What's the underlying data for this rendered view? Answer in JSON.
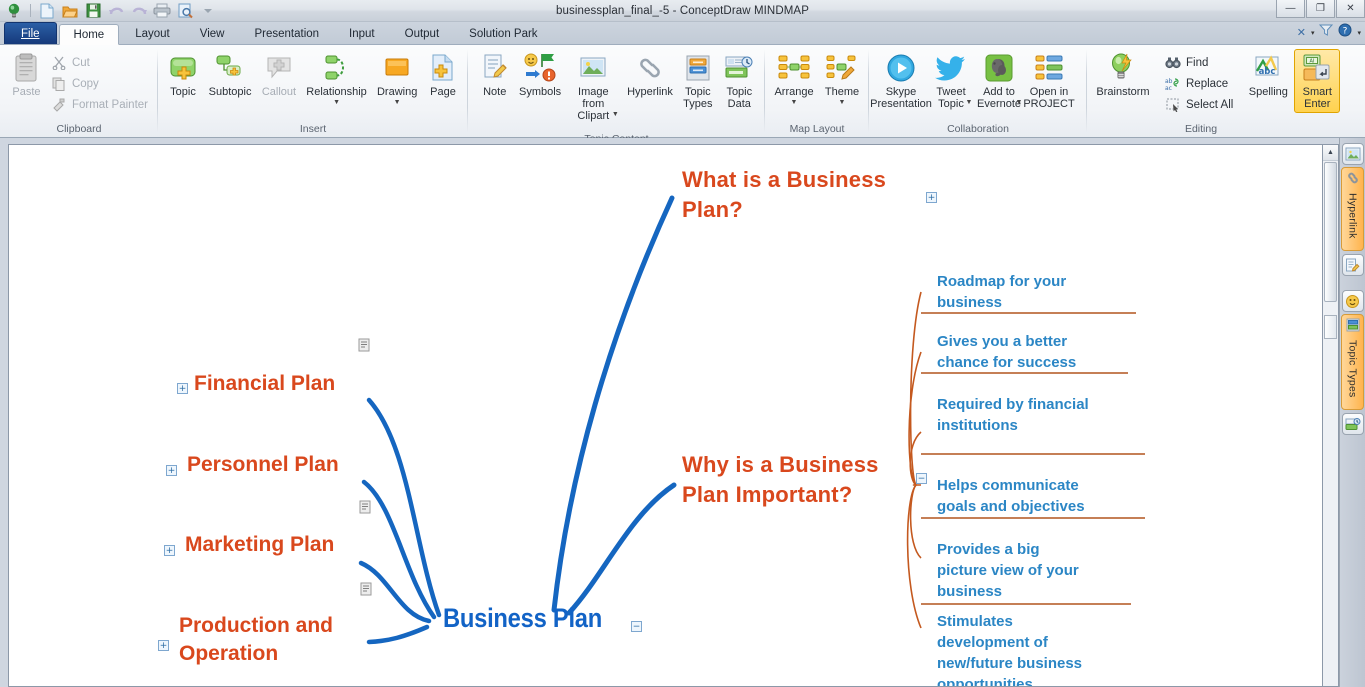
{
  "window": {
    "title": "businessplan_final_-5 - ConceptDraw MINDMAP",
    "controls": {
      "minimize": "—",
      "restore": "❐",
      "close": "✕"
    }
  },
  "quick_access": [
    {
      "name": "app-logo-icon",
      "label": "ConceptDraw"
    },
    {
      "name": "new-icon",
      "label": "New"
    },
    {
      "name": "open-icon",
      "label": "Open"
    },
    {
      "name": "save-icon",
      "label": "Save"
    },
    {
      "name": "undo-icon",
      "label": "Undo"
    },
    {
      "name": "redo-icon",
      "label": "Redo"
    },
    {
      "name": "print-icon",
      "label": "Print"
    },
    {
      "name": "print-preview-icon",
      "label": "Print Preview"
    },
    {
      "name": "qat-overflow-icon",
      "label": "Customize Quick Access Toolbar"
    }
  ],
  "tabs": [
    {
      "label": "File",
      "active": false,
      "file": true
    },
    {
      "label": "Home",
      "active": true
    },
    {
      "label": "Layout",
      "active": false
    },
    {
      "label": "View",
      "active": false
    },
    {
      "label": "Presentation",
      "active": false
    },
    {
      "label": "Input",
      "active": false
    },
    {
      "label": "Output",
      "active": false
    },
    {
      "label": "Solution Park",
      "active": false
    }
  ],
  "tabstrip_right": {
    "clear_label": "✕",
    "dropdown_label": "▾",
    "filter_label": "filter-icon",
    "help_label": "?"
  },
  "ribbon": {
    "groups": [
      {
        "name": "Clipboard",
        "big": [
          {
            "label": "Paste",
            "icon": "clipboard-icon",
            "disabled": true
          }
        ],
        "small": [
          {
            "label": "Cut",
            "icon": "scissors-icon",
            "disabled": true
          },
          {
            "label": "Copy",
            "icon": "copy-icon",
            "disabled": true
          },
          {
            "label": "Format Painter",
            "icon": "format-painter-icon",
            "disabled": true
          }
        ]
      },
      {
        "name": "Insert",
        "big": [
          {
            "label": "Topic",
            "icon": "topic-add-icon",
            "disabled": false
          },
          {
            "label": "Subtopic",
            "icon": "subtopic-add-icon",
            "disabled": false
          },
          {
            "label": "Callout",
            "icon": "callout-icon",
            "disabled": true
          },
          {
            "label": "Relationship",
            "icon": "relationship-icon",
            "disabled": false,
            "caret": true
          },
          {
            "label": "Drawing",
            "icon": "drawing-icon",
            "disabled": false,
            "caret": true
          },
          {
            "label": "Page",
            "icon": "page-add-icon",
            "disabled": false
          }
        ]
      },
      {
        "name": "Topic Content",
        "big": [
          {
            "label": "Note",
            "icon": "note-icon",
            "disabled": false
          },
          {
            "label": "Symbols",
            "icon": "symbols-icon",
            "disabled": false
          },
          {
            "label": "Image from Clipart",
            "icon": "image-clipart-icon",
            "disabled": false,
            "caret": true
          },
          {
            "label": "Hyperlink",
            "icon": "hyperlink-icon",
            "disabled": false
          },
          {
            "label": "Topic Types",
            "icon": "topic-types-icon",
            "disabled": false
          },
          {
            "label": "Topic Data",
            "icon": "topic-data-icon",
            "disabled": false
          }
        ]
      },
      {
        "name": "Map Layout",
        "big": [
          {
            "label": "Arrange",
            "icon": "arrange-icon",
            "disabled": false,
            "caret": true
          },
          {
            "label": "Theme",
            "icon": "theme-icon",
            "disabled": false,
            "caret": true
          }
        ]
      },
      {
        "name": "Collaboration",
        "big": [
          {
            "label": "Skype Presentation",
            "icon": "skype-icon",
            "disabled": false
          },
          {
            "label": "Tweet Topic",
            "icon": "twitter-icon",
            "disabled": false,
            "caret": true
          },
          {
            "label": "Add to Evernote",
            "icon": "evernote-icon",
            "disabled": false,
            "caret": true
          },
          {
            "label": "Open in PROJECT",
            "icon": "project-icon",
            "disabled": false
          }
        ]
      },
      {
        "name": "Editing",
        "big": [
          {
            "label": "Brainstorm",
            "icon": "brainstorm-icon",
            "disabled": false
          }
        ],
        "small": [
          {
            "label": "Find",
            "icon": "find-icon",
            "disabled": false
          },
          {
            "label": "Replace",
            "icon": "replace-icon",
            "disabled": false
          },
          {
            "label": "Select All",
            "icon": "select-all-icon",
            "disabled": false
          }
        ],
        "big2": [
          {
            "label": "Spelling",
            "icon": "spelling-icon",
            "disabled": false
          },
          {
            "label": "Smart Enter",
            "icon": "smart-enter-icon",
            "disabled": false,
            "selected": true
          }
        ]
      }
    ]
  },
  "dock": {
    "icons": [
      {
        "name": "clipart-pane-icon",
        "label": "Clipart"
      },
      {
        "name": "note-pane-icon",
        "label": "Note"
      },
      {
        "name": "symbols-pane-icon",
        "label": "Symbols"
      },
      {
        "name": "topic-data-pane-icon",
        "label": "Topic Data"
      }
    ],
    "tabs": [
      {
        "name": "hyperlink-pane-tab",
        "label": "Hyperlink"
      },
      {
        "name": "topic-types-pane-tab",
        "label": "Topic Types"
      }
    ]
  },
  "scrollbar": {
    "up_arrow": "▲",
    "down_arrow": "▼"
  },
  "mindmap": {
    "center": {
      "label": "Business Plan",
      "collapse": "−",
      "color": "#1263c6"
    },
    "right_topics": [
      {
        "label": "What is a Business\nPlan?",
        "expand": "+",
        "color": "#d9481d"
      },
      {
        "label": "Why is a Business\nPlan Important?",
        "collapse": "−",
        "color": "#d9481d"
      }
    ],
    "right_subtopics": [
      {
        "label": "Roadmap for your\nbusiness"
      },
      {
        "label": "Gives you a better\nchance for success"
      },
      {
        "label": "Required by financial\ninstitutions"
      },
      {
        "label": "Helps communicate\ngoals and objectives"
      },
      {
        "label": "Provides a big\npicture view of your\nbusiness"
      },
      {
        "label": "Stimulates\ndevelopment of\nnew/future business\nopportunities"
      }
    ],
    "left_topics": [
      {
        "label": "Financial Plan",
        "expand": "+",
        "note": true
      },
      {
        "label": "Personnel Plan",
        "expand": "+",
        "note": false
      },
      {
        "label": "Marketing Plan",
        "expand": "+",
        "note": true
      },
      {
        "label": "Production and\nOperation",
        "expand": "+",
        "note": true
      }
    ],
    "colors": {
      "topic": "#d9481d",
      "subtopic": "#2b86c5",
      "center": "#1263c6",
      "branch_blue": "#1566c0",
      "branch_orange": "#c4591f"
    }
  }
}
